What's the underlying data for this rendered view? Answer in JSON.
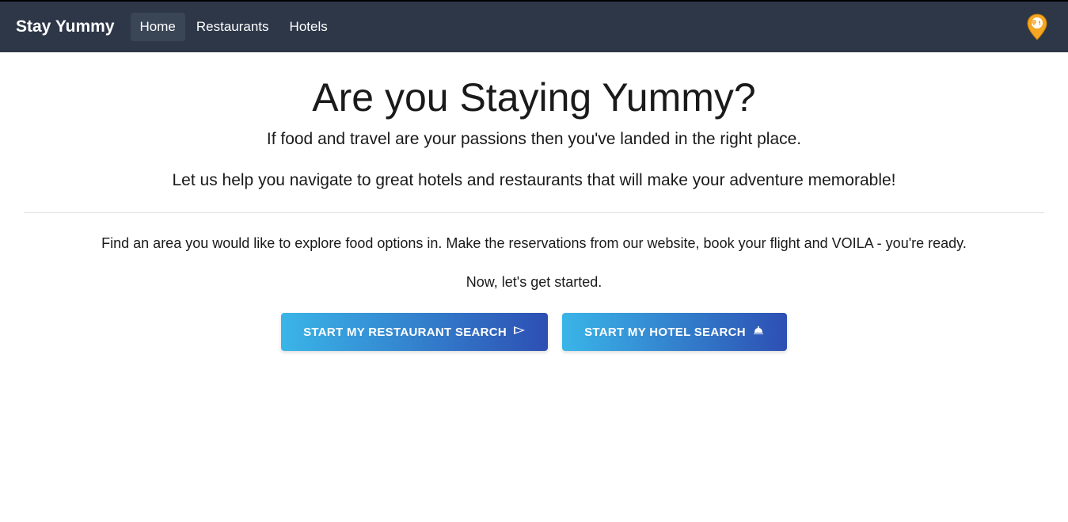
{
  "navbar": {
    "brand": "Stay Yummy",
    "items": [
      {
        "label": "Home",
        "active": true
      },
      {
        "label": "Restaurants",
        "active": false
      },
      {
        "label": "Hotels",
        "active": false
      }
    ]
  },
  "hero": {
    "title": "Are you Staying Yummy?",
    "subtitle": "If food and travel are your passions then you've landed in the right place.",
    "tagline": "Let us help you navigate to great hotels and restaurants that will make your adventure memorable!",
    "description": "Find an area you would like to explore food options in. Make the reservations from our website, book your flight and VOILA - you're ready.",
    "get_started": "Now, let's get started."
  },
  "buttons": {
    "restaurant_search": "START MY RESTAURANT SEARCH",
    "hotel_search": "START MY HOTEL SEARCH"
  },
  "colors": {
    "navbar_bg": "#2d3748",
    "button_gradient_start": "#3ab5e8",
    "button_gradient_end": "#2d4fb3",
    "logo_accent": "#f5a623"
  }
}
